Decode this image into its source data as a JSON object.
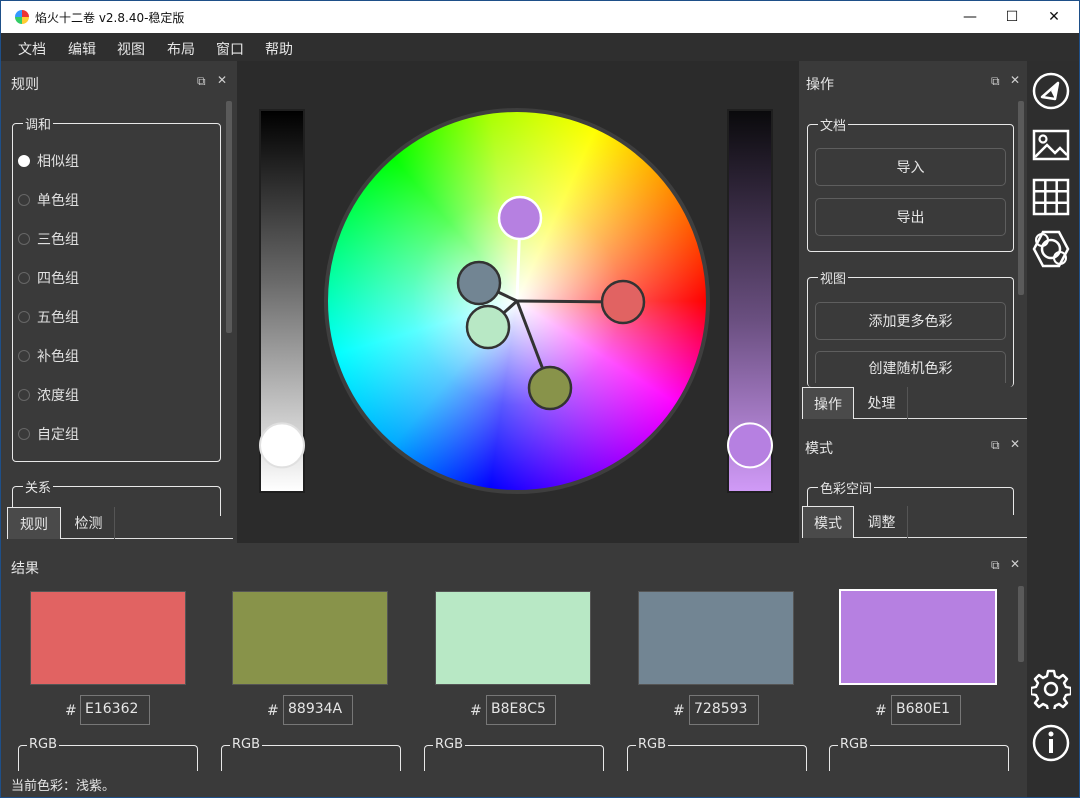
{
  "titlebar": {
    "title": "焰火十二卷 v2.8.40-稳定版",
    "minimize": "—",
    "maximize": "☐",
    "close": "✕"
  },
  "menu": [
    "文档",
    "编辑",
    "视图",
    "布局",
    "窗口",
    "帮助"
  ],
  "rules_panel": {
    "title": "规则",
    "harmony_label": "调和",
    "options": [
      "相似组",
      "单色组",
      "三色组",
      "四色组",
      "五色组",
      "补色组",
      "浓度组",
      "自定组"
    ],
    "selected": "相似组",
    "relation_label": "关系",
    "tabs": [
      "规则",
      "检测"
    ],
    "active_tab": "规则"
  },
  "ops_panel": {
    "title": "操作",
    "doc_group": "文档",
    "import_label": "导入",
    "export_label": "导出",
    "view_group": "视图",
    "add_colors_label": "添加更多色彩",
    "random_colors_label": "创建随机色彩",
    "tabs": [
      "操作",
      "处理"
    ],
    "active_tab": "操作"
  },
  "mode_panel": {
    "title": "模式",
    "colorspace_group": "色彩空间",
    "tabs": [
      "模式",
      "调整"
    ],
    "active_tab": "模式"
  },
  "results_panel": {
    "title": "结果",
    "hash": "#",
    "rgb_label": "RGB",
    "swatches": [
      {
        "hex": "E16362",
        "color": "#E16362"
      },
      {
        "hex": "88934A",
        "color": "#88934A"
      },
      {
        "hex": "B8E8C5",
        "color": "#B8E8C5"
      },
      {
        "hex": "728593",
        "color": "#728593"
      },
      {
        "hex": "B680E1",
        "color": "#B680E1",
        "selected": true
      }
    ]
  },
  "wheel": {
    "brightness_level": 0.88,
    "saturation_level": 0.88,
    "slider_right_color": "#B680E1"
  },
  "status": {
    "text": "当前色彩：浅紫。"
  },
  "icons": {
    "panel_float": "float-icon",
    "panel_close": "close-icon",
    "sidebar": [
      "wheel-icon",
      "image-icon",
      "grid-icon",
      "blend-icon",
      "gear-icon",
      "info-icon"
    ]
  }
}
